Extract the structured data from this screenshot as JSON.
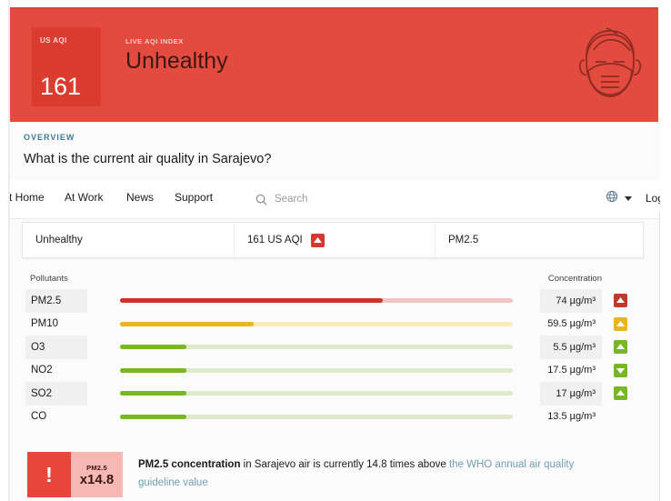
{
  "banner": {
    "aqi_label": "US AQI",
    "aqi_value": "161",
    "kicker": "LIVE AQI INDEX",
    "status": "Unhealthy",
    "face_icon": "masked-face-icon",
    "bg_color": "#e24b3e",
    "box_color": "#dc3c30"
  },
  "overview": {
    "kicker": "OVERVIEW",
    "title": "What is the current air quality in Sarajevo?"
  },
  "nav": {
    "items": [
      {
        "label": "At Home"
      },
      {
        "label": "At Work"
      },
      {
        "label": "News"
      },
      {
        "label": "Support"
      }
    ],
    "search_placeholder": "Search",
    "search_value": "",
    "search_icon": "search-icon",
    "globe_icon": "globe-icon",
    "chevron_icon": "chevron-down-icon",
    "login_label": "Login"
  },
  "summary": {
    "status": "Unhealthy",
    "aqi": "161 US AQI",
    "aqi_trend": "up",
    "aqi_trend_color": "#d13b2e",
    "main_pollutant": "PM2.5"
  },
  "pollutants_table": {
    "col_pollutants": "Pollutants",
    "col_concentration": "Concentration",
    "rows": [
      {
        "name": "PM2.5",
        "concentration": "74 µg/m³",
        "fill_pct": 67,
        "fill_color": "#c0392b",
        "track_color": "#f1c6c2",
        "trend": "up",
        "trend_color": "#c0392b"
      },
      {
        "name": "PM10",
        "concentration": "59.5 µg/m³",
        "fill_pct": 34,
        "fill_color": "#eab521",
        "track_color": "#f7ecb8",
        "trend": "up",
        "trend_color": "#eab521"
      },
      {
        "name": "O3",
        "concentration": "5.5 µg/m³",
        "fill_pct": 17,
        "fill_color": "#76b722",
        "track_color": "#dfeac8",
        "trend": "up",
        "trend_color": "#76b722"
      },
      {
        "name": "NO2",
        "concentration": "17.5 µg/m³",
        "fill_pct": 17,
        "fill_color": "#76b722",
        "track_color": "#dfeac8",
        "trend": "down",
        "trend_color": "#76b722"
      },
      {
        "name": "SO2",
        "concentration": "17 µg/m³",
        "fill_pct": 17,
        "fill_color": "#76b722",
        "track_color": "#dfeac8",
        "trend": "up",
        "trend_color": "#76b722"
      },
      {
        "name": "CO",
        "concentration": "13.5 µg/m³",
        "fill_pct": 17,
        "fill_color": "#76b722",
        "track_color": "#dfeac8",
        "trend": "",
        "trend_color": ""
      }
    ]
  },
  "who_banner": {
    "bang": "!",
    "badge_pollutant": "PM2.5",
    "badge_multiplier": "x14.8",
    "text_bold": "PM2.5 concentration",
    "text_mid": " in Sarajevo air is currently 14.8 times above ",
    "text_link": "the WHO annual air quality guideline value"
  }
}
